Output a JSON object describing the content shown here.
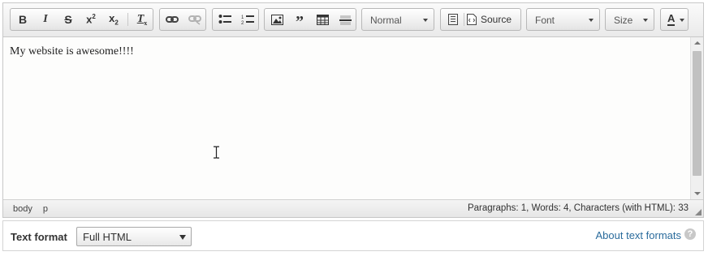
{
  "toolbar": {
    "format_combo": "Normal",
    "source_label": "Source",
    "font_combo": "Font",
    "size_combo": "Size",
    "text_color_label": "A"
  },
  "editor": {
    "content_text": "My website is awesome!!!!"
  },
  "statusbar": {
    "path": [
      "body",
      "p"
    ],
    "counts": "Paragraphs: 1, Words: 4, Characters (with HTML): 33"
  },
  "text_format": {
    "label": "Text format",
    "selected": "Full HTML",
    "help_link": "About text formats",
    "help_icon_glyph": "?"
  },
  "colors": {
    "link": "#2a6b9c",
    "border": "#c8c8c8",
    "scroll_thumb": "#c1c1c1"
  }
}
